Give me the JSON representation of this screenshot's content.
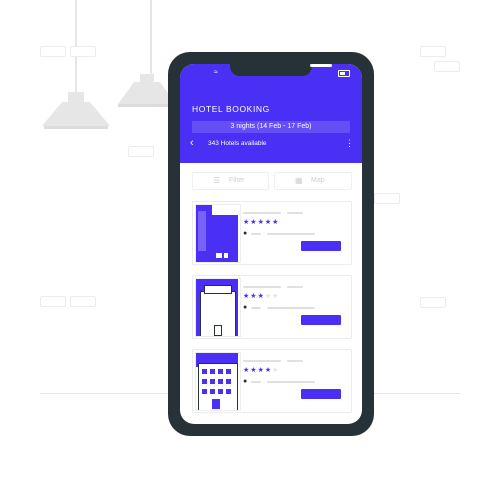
{
  "colors": {
    "accent": "#4a2ff5",
    "phone": "#263238",
    "decor": "#e6e6e6"
  },
  "app": {
    "title": "HOTEL BOOKING",
    "date_range": "3 nights (14 Feb - 17 Feb)",
    "results_count": "343 Hotels available",
    "back_icon": "chevron-left-icon",
    "menu_icon": "kebab-menu-icon"
  },
  "toolbar": {
    "filter_label": "Filter",
    "filter_icon": "sliders-icon",
    "map_label": "Map",
    "map_icon": "map-icon"
  },
  "hotels": [
    {
      "rating": 5,
      "max_rating": 5
    },
    {
      "rating": 3,
      "max_rating": 5
    },
    {
      "rating": 4,
      "max_rating": 5
    }
  ]
}
